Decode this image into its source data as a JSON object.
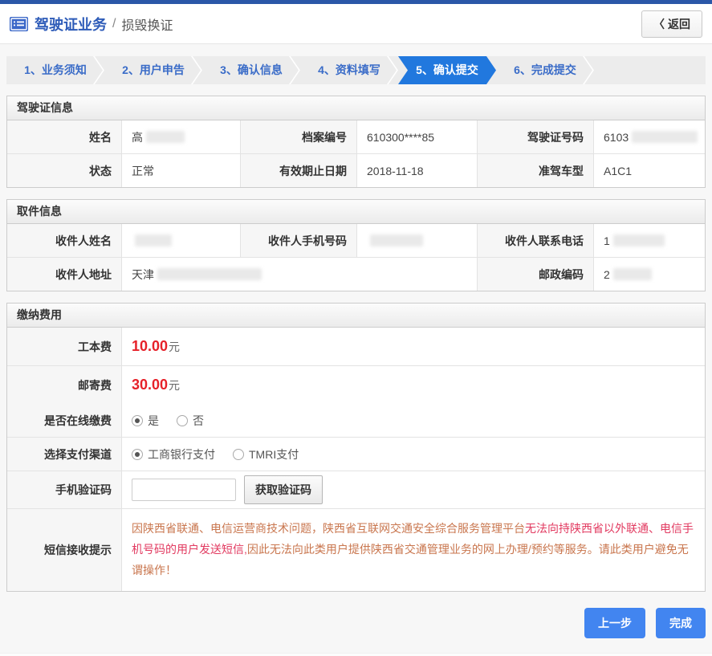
{
  "header": {
    "title": "驾驶证业务",
    "separator": "/",
    "subtitle": "损毁换证",
    "back_icon": "〈",
    "back_label": "返回"
  },
  "steps": [
    {
      "label": "1、业务须知",
      "active": false
    },
    {
      "label": "2、用户申告",
      "active": false
    },
    {
      "label": "3、确认信息",
      "active": false
    },
    {
      "label": "4、资料填写",
      "active": false
    },
    {
      "label": "5、确认提交",
      "active": true
    },
    {
      "label": "6、完成提交",
      "active": false
    }
  ],
  "license_section": {
    "title": "驾驶证信息",
    "rows": [
      [
        {
          "label": "姓名",
          "value": "高",
          "redacted": true,
          "redact_width": 48
        },
        {
          "label": "档案编号",
          "value": "610300****85",
          "redacted": false
        },
        {
          "label": "驾驶证号码",
          "value": "6103",
          "redacted": true,
          "redact_width": 82
        }
      ],
      [
        {
          "label": "状态",
          "value": "正常",
          "redacted": false
        },
        {
          "label": "有效期止日期",
          "value": "2018-11-18",
          "redacted": false
        },
        {
          "label": "准驾车型",
          "value": "A1C1",
          "redacted": false
        }
      ]
    ]
  },
  "pickup_section": {
    "title": "取件信息",
    "row1": [
      {
        "label": "收件人姓名",
        "value": "",
        "redacted": true,
        "redact_width": 46
      },
      {
        "label": "收件人手机号码",
        "value": "",
        "redacted": true,
        "redact_width": 66
      },
      {
        "label": "收件人联系电话",
        "value": "1",
        "redacted": true,
        "redact_width": 64
      }
    ],
    "row2": {
      "address": {
        "label": "收件人地址",
        "value": "天津",
        "redacted": true,
        "redact_width": 130
      },
      "postcode": {
        "label": "邮政编码",
        "value": "2",
        "redacted": true,
        "redact_width": 48
      }
    }
  },
  "payment_section": {
    "title": "缴纳费用",
    "fees": [
      {
        "label": "工本费",
        "amount": "10.00",
        "unit": "元"
      },
      {
        "label": "邮寄费",
        "amount": "30.00",
        "unit": "元"
      }
    ],
    "online_pay": {
      "label": "是否在线缴费",
      "options": [
        {
          "text": "是",
          "selected": true
        },
        {
          "text": "否",
          "selected": false
        }
      ]
    },
    "channel": {
      "label": "选择支付渠道",
      "options": [
        {
          "text": "工商银行支付",
          "selected": true
        },
        {
          "text": "TMRI支付",
          "selected": false
        }
      ]
    },
    "sms": {
      "label": "手机验证码",
      "input_value": "",
      "button_label": "获取验证码"
    },
    "notice": {
      "label": "短信接收提示",
      "part1": "因陕西省联通、电信运营商技术问题，陕西省互联网交通安全综合服务管理平台",
      "emphasis": "无法向持陕西省以外联通、电信手机号码的用户发送短信,",
      "part2": "因此无法向此类用户提供陕西省交通管理业务的网上办理/预约等服务。请此类用户避免无谓操作！"
    }
  },
  "footer": {
    "prev_label": "上一步",
    "finish_label": "完成"
  },
  "colors": {
    "top_bar": "#2b57a8",
    "step_active": "#2178de",
    "step_text": "#3a6cc8",
    "fee_red": "#e62129",
    "notice_normal": "#c9764e",
    "notice_emphasis": "#e23a60",
    "action_blue": "#4285f0"
  }
}
